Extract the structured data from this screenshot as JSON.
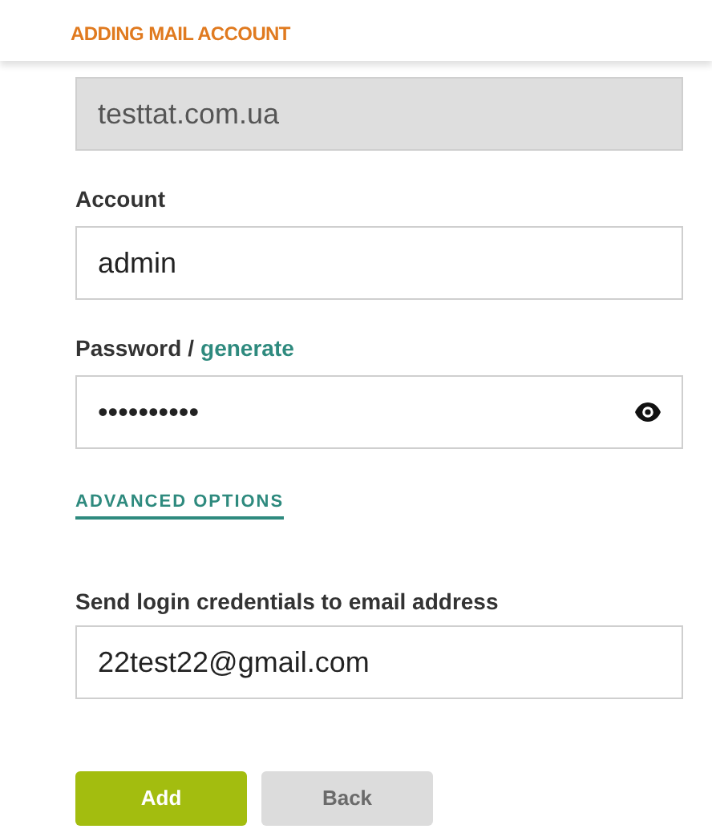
{
  "header": {
    "title": "ADDING MAIL ACCOUNT"
  },
  "domain_field": {
    "value": "testtat.com.ua",
    "disabled": true
  },
  "account": {
    "label": "Account",
    "value": "admin"
  },
  "password": {
    "label": "Password",
    "separator": "/",
    "generate_link": "generate",
    "value": "••••••••••"
  },
  "advanced_options_link": "ADVANCED OPTIONS",
  "send_credentials": {
    "label": "Send login credentials to email address",
    "value": "22test22@gmail.com"
  },
  "buttons": [
    {
      "label": "Add",
      "kind": "primary"
    },
    {
      "label": "Back",
      "kind": "secondary"
    }
  ]
}
